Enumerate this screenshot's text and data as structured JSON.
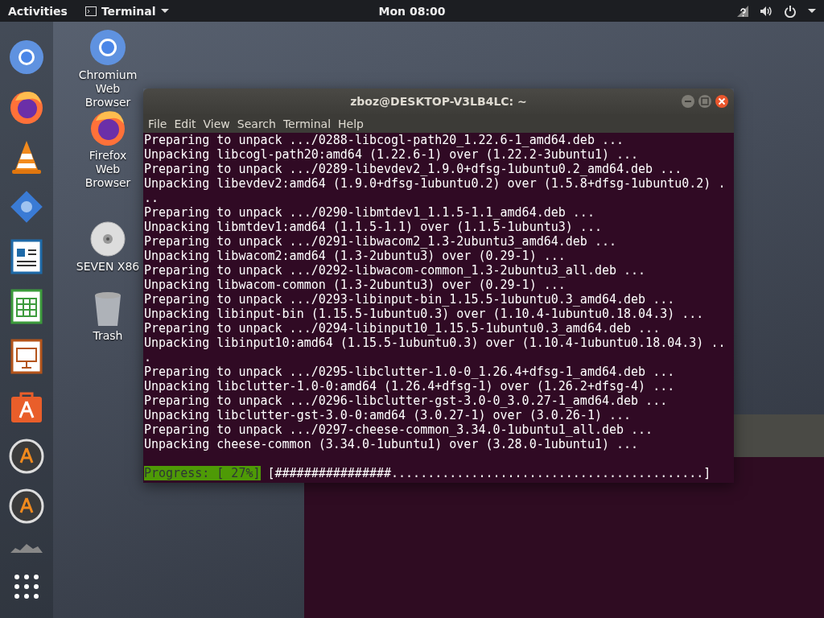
{
  "top_bar": {
    "activities": "Activities",
    "app_menu": "Terminal",
    "clock": "Mon 08:00"
  },
  "desktop_icons": [
    {
      "label": "Chromium Web Browser"
    },
    {
      "label": "Firefox Web Browser"
    },
    {
      "label": "SEVEN X86"
    },
    {
      "label": "Trash"
    }
  ],
  "terminal": {
    "title": "zboz@DESKTOP-V3LB4LC: ~",
    "menu": [
      "File",
      "Edit",
      "View",
      "Search",
      "Terminal",
      "Help"
    ],
    "lines": [
      "Preparing to unpack .../0288-libcogl-path20_1.22.6-1_amd64.deb ...",
      "Unpacking libcogl-path20:amd64 (1.22.6-1) over (1.22.2-3ubuntu1) ...",
      "Preparing to unpack .../0289-libevdev2_1.9.0+dfsg-1ubuntu0.2_amd64.deb ...",
      "Unpacking libevdev2:amd64 (1.9.0+dfsg-1ubuntu0.2) over (1.5.8+dfsg-1ubuntu0.2) .",
      "..",
      "Preparing to unpack .../0290-libmtdev1_1.1.5-1.1_amd64.deb ...",
      "Unpacking libmtdev1:amd64 (1.1.5-1.1) over (1.1.5-1ubuntu3) ...",
      "Preparing to unpack .../0291-libwacom2_1.3-2ubuntu3_amd64.deb ...",
      "Unpacking libwacom2:amd64 (1.3-2ubuntu3) over (0.29-1) ...",
      "Preparing to unpack .../0292-libwacom-common_1.3-2ubuntu3_all.deb ...",
      "Unpacking libwacom-common (1.3-2ubuntu3) over (0.29-1) ...",
      "Preparing to unpack .../0293-libinput-bin_1.15.5-1ubuntu0.3_amd64.deb ...",
      "Unpacking libinput-bin (1.15.5-1ubuntu0.3) over (1.10.4-1ubuntu0.18.04.3) ...",
      "Preparing to unpack .../0294-libinput10_1.15.5-1ubuntu0.3_amd64.deb ...",
      "Unpacking libinput10:amd64 (1.15.5-1ubuntu0.3) over (1.10.4-1ubuntu0.18.04.3) ..",
      ".",
      "Preparing to unpack .../0295-libclutter-1.0-0_1.26.4+dfsg-1_amd64.deb ...",
      "Unpacking libclutter-1.0-0:amd64 (1.26.4+dfsg-1) over (1.26.2+dfsg-4) ...",
      "Preparing to unpack .../0296-libclutter-gst-3.0-0_3.0.27-1_amd64.deb ...",
      "Unpacking libclutter-gst-3.0-0:amd64 (3.0.27-1) over (3.0.26-1) ...",
      "Preparing to unpack .../0297-cheese-common_3.34.0-1ubuntu1_all.deb ...",
      "Unpacking cheese-common (3.34.0-1ubuntu1) over (3.28.0-1ubuntu1) ..."
    ],
    "progress_label": "Progress: [ 27%]",
    "progress_bar": "[################...........................................]"
  }
}
